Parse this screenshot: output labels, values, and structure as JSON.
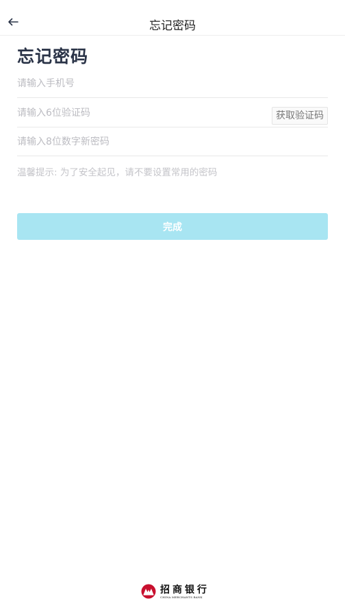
{
  "header": {
    "title": "忘记密码",
    "back_icon": "arrow-left-icon"
  },
  "page": {
    "title": "忘记密码"
  },
  "form": {
    "phone": {
      "placeholder": "请输入手机号",
      "value": ""
    },
    "code": {
      "placeholder": "请输入6位验证码",
      "value": ""
    },
    "get_code_label": "获取验证码",
    "password": {
      "placeholder": "请输入8位数字新密码",
      "value": ""
    },
    "tip": "温馨提示: 为了安全起见，请不要设置常用的密码",
    "submit_label": "完成"
  },
  "footer": {
    "bank_name_cn": "招商银行",
    "bank_name_en": "CHINA MERCHANTS BANK",
    "logo_icon": "cmb-logo-icon"
  },
  "colors": {
    "submit_bg": "#a8e5f2",
    "title_text": "#2a3347",
    "placeholder": "#bcbcc2",
    "logo_red": "#c8102e"
  }
}
